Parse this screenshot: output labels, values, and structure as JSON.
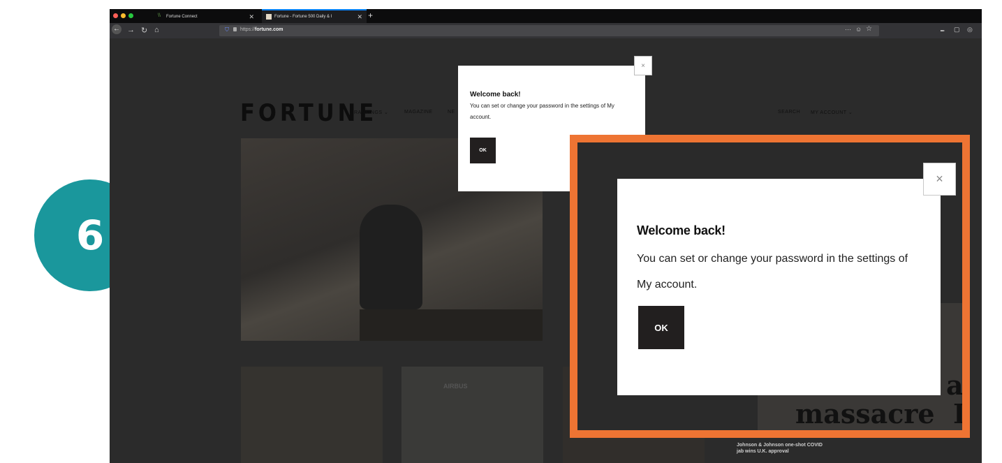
{
  "step": {
    "number": "6"
  },
  "browser": {
    "tabs": [
      {
        "title": "Fortune Connect",
        "active": false
      },
      {
        "title": "Fortune - Fortune 500 Daily & I",
        "active": true
      }
    ],
    "new_tab": "+",
    "tab_close": "✕",
    "url": {
      "scheme": "https://",
      "host": "fortune.com"
    },
    "nav_icons": [
      "back-icon",
      "forward-icon",
      "reload-icon",
      "home-icon"
    ],
    "right_icons": [
      "•••",
      "pocket-icon",
      "star-icon",
      "library-icon",
      "sidebar-icon",
      "account-icon"
    ],
    "right_symbols": {
      "more": "···",
      "pocket": "☺",
      "star": "☆",
      "library": "⑉",
      "sidebar": "▢",
      "account": "◎"
    }
  },
  "site": {
    "logo": "FORTUNE",
    "nav": {
      "rankings": "RANKINGS ⌄",
      "magazine": "MAGAZINE",
      "ne": "NE",
      "search": "SEARCH",
      "my_account": "MY ACCOUNT ⌄"
    },
    "image_text": "AIRBUS",
    "bg_fragment": "NE",
    "headline_fragment": {
      "a": "a",
      "massacre": "massacre",
      "l": "I"
    },
    "news": [
      "Johnson & Johnson one-shot COVID",
      "jab wins U.K. approval"
    ]
  },
  "dialog": {
    "title": "Welcome back!",
    "message": "You can set or change your password in the settings of My account.",
    "ok_label": "OK",
    "close_label": "×"
  },
  "colors": {
    "badge": "#1a979c",
    "highlight": "#ee7433",
    "ok_button": "#221f1f"
  }
}
